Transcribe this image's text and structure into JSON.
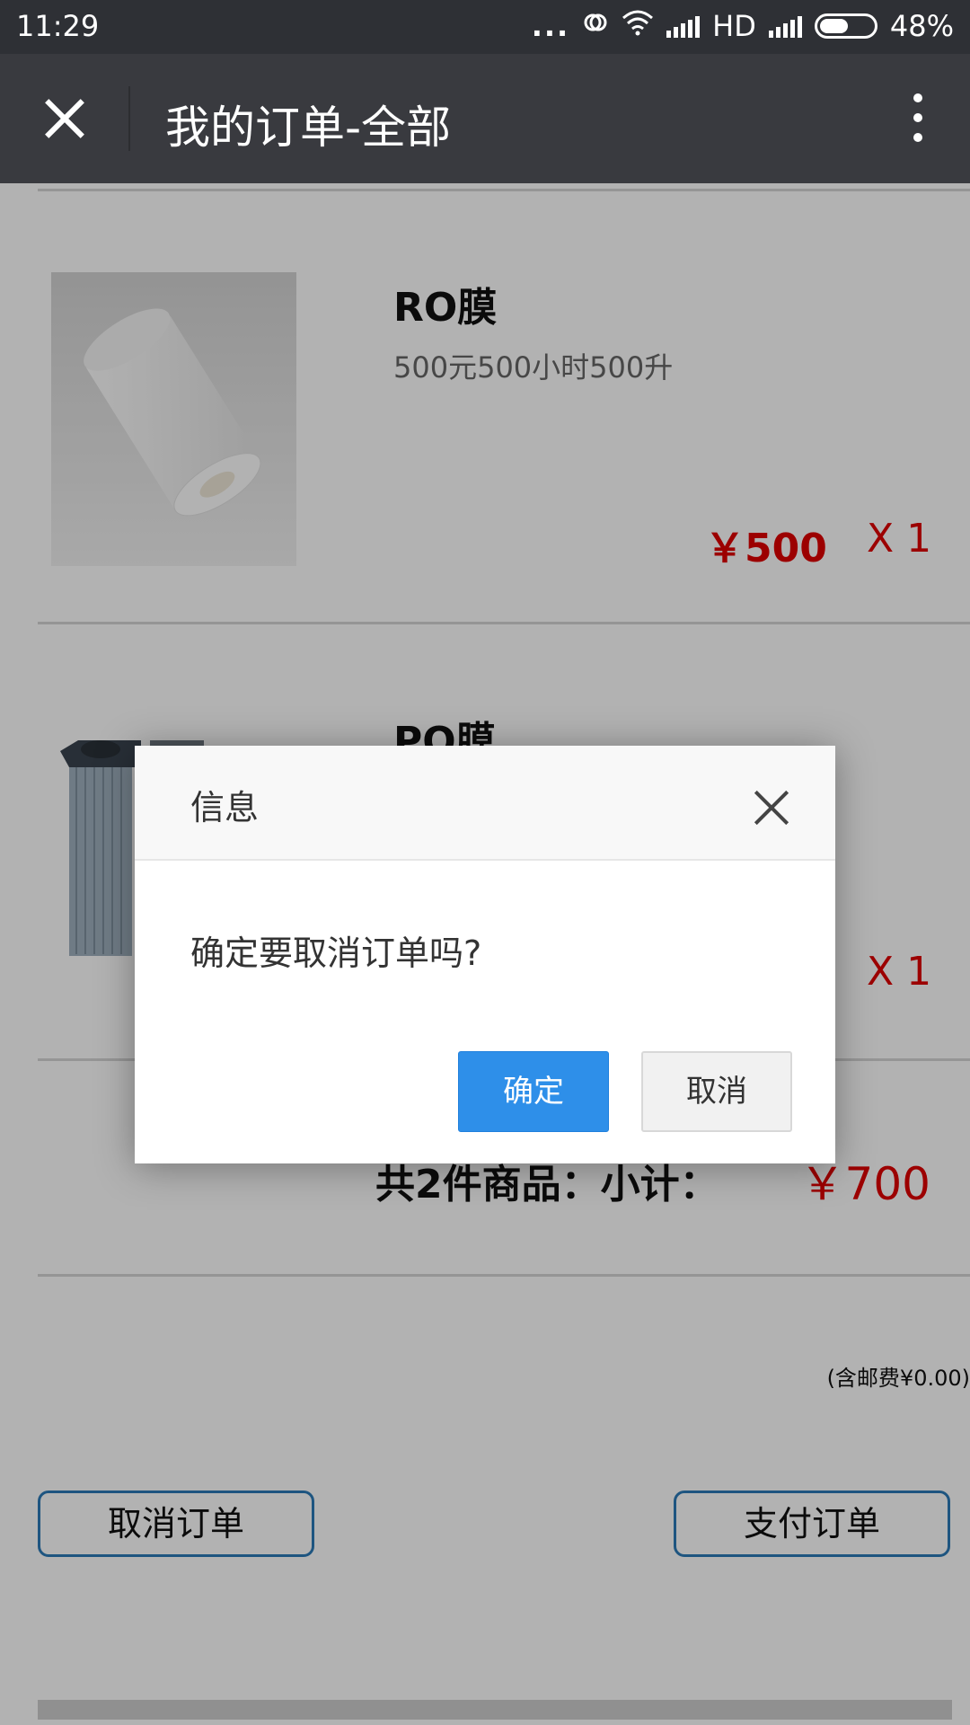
{
  "status_bar": {
    "time": "11:29",
    "dots": "...",
    "network": "HD",
    "battery": "48%"
  },
  "title_bar": {
    "title": "我的订单-全部"
  },
  "order": {
    "items": [
      {
        "name": "RO膜",
        "desc": "500元500小时500升",
        "price": "￥500",
        "qty": "X 1"
      },
      {
        "name": "PO膜",
        "desc": "",
        "price": "",
        "qty": "X 1"
      }
    ],
    "summary": "共2件商品：小计：",
    "total": "￥700",
    "shipping": "(含邮费¥0.00)",
    "cancel_order_label": "取消订单",
    "pay_order_label": "支付订单"
  },
  "dialog": {
    "title": "信息",
    "message": "确定要取消订单吗?",
    "confirm_label": "确定",
    "cancel_label": "取消"
  },
  "colors": {
    "accent": "#2e8fe9",
    "price_red": "#e00000",
    "title_bar": "#393a3f"
  }
}
